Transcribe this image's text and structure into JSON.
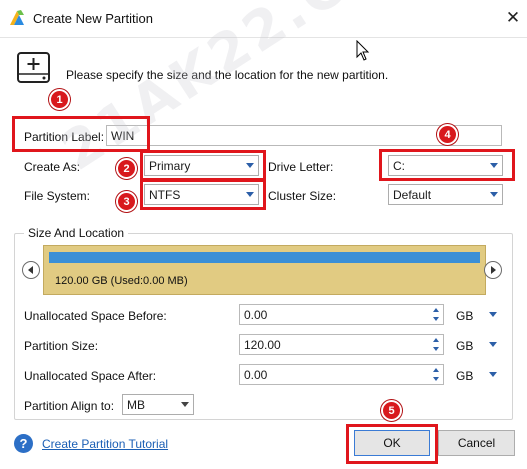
{
  "window": {
    "title": "Create New Partition",
    "close_glyph": "✕"
  },
  "header": {
    "description": "Please specify the size and the location for the new partition."
  },
  "form": {
    "partition_label": {
      "label": "Partition Label:",
      "value": "WIN"
    },
    "create_as": {
      "label": "Create As:",
      "value": "Primary"
    },
    "file_system": {
      "label": "File System:",
      "value": "NTFS"
    },
    "drive_letter": {
      "label": "Drive Letter:",
      "value": "C:"
    },
    "cluster_size": {
      "label": "Cluster Size:",
      "value": "Default"
    }
  },
  "size_location": {
    "title": "Size And Location",
    "partition_bar_text": "120.00 GB (Used:0.00 MB)",
    "fields": [
      {
        "label": "Unallocated Space Before:",
        "value": "0.00",
        "unit": "GB"
      },
      {
        "label": "Partition Size:",
        "value": "120.00",
        "unit": "GB"
      },
      {
        "label": "Unallocated Space After:",
        "value": "0.00",
        "unit": "GB"
      }
    ],
    "align": {
      "label": "Partition Align to:",
      "value": "MB"
    }
  },
  "footer": {
    "help_glyph": "?",
    "tutorial_link": "Create Partition Tutorial",
    "ok_label": "OK",
    "cancel_label": "Cancel"
  },
  "annotations": [
    "1",
    "2",
    "3",
    "4",
    "5"
  ],
  "watermark": "21AK22.COM",
  "colors": {
    "highlight": "#e0161c",
    "partition_bar": "#e1cb82",
    "partition_fill": "#3a8fd6",
    "link": "#1b5fb5"
  },
  "icons": [
    "app-icon",
    "close-icon",
    "mouse-cursor-icon",
    "disk-add-icon",
    "chevron-down-icon",
    "chevron-left-icon",
    "chevron-right-icon",
    "help-icon"
  ]
}
